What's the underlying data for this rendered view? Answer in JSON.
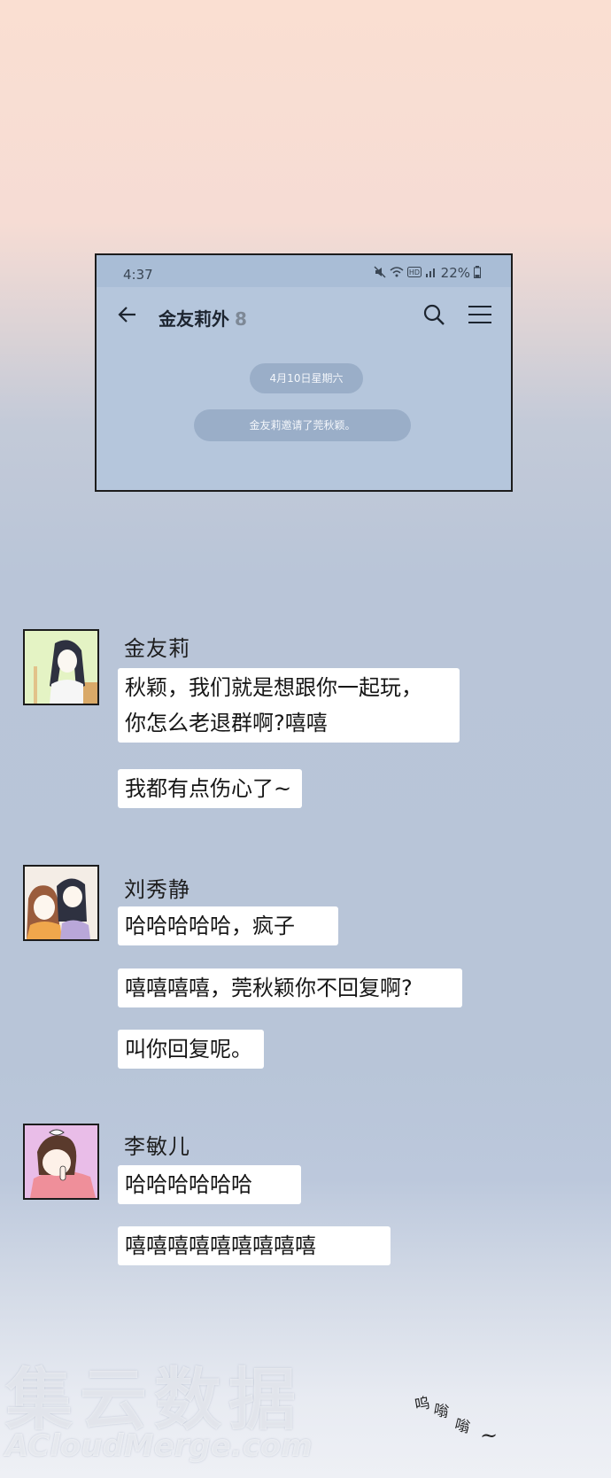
{
  "phone": {
    "status": {
      "time": "4:37",
      "icons": [
        "mute-icon",
        "wifi-icon",
        "hd-icon",
        "signal-icon",
        "battery-icon"
      ],
      "battery_percent": "22%"
    },
    "title": "金友莉外",
    "member_count": "8",
    "date_label": "4月10日星期六",
    "system_notice": "金友莉邀请了莞秋颖。"
  },
  "messages": [
    {
      "sender": "金友莉",
      "avatar_color": "#e4f3c4",
      "bubbles": [
        "秋颖，我们就是想跟你一起玩，",
        "你怎么老退群啊?嘻嘻",
        "我都有点伤心了~"
      ]
    },
    {
      "sender": "刘秀静",
      "avatar_color": "#f4ede6",
      "bubbles": [
        "哈哈哈哈哈，疯子",
        "嘻嘻嘻嘻，莞秋颖你不回复啊?",
        "叫你回复呢。"
      ]
    },
    {
      "sender": "李敏儿",
      "avatar_color": "#e9bde8",
      "bubbles": [
        "哈哈哈哈哈哈",
        "嘻嘻嘻嘻嘻嘻嘻嘻嘻"
      ]
    }
  ],
  "sfx": [
    "呜",
    "嗡",
    "嗡",
    "~"
  ],
  "watermark": {
    "cn": "集云数据",
    "en": "ACloudMerge.com"
  }
}
